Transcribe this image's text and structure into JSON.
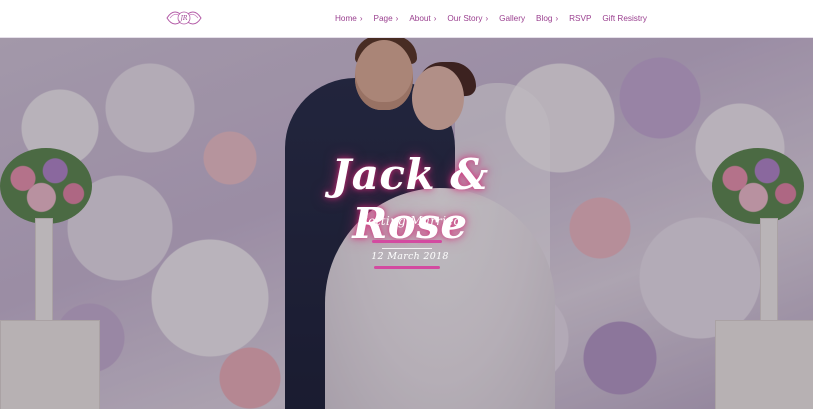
{
  "brand": {
    "logo_text": "JR",
    "accent": "#9a3f8f"
  },
  "nav": {
    "items": [
      {
        "label": "Home",
        "dropdown": true
      },
      {
        "label": "Page",
        "dropdown": true
      },
      {
        "label": "About",
        "dropdown": true
      },
      {
        "label": "Our Story",
        "dropdown": true
      },
      {
        "label": "Gallery",
        "dropdown": false
      },
      {
        "label": "Blog",
        "dropdown": true
      },
      {
        "label": "RSVP",
        "dropdown": false
      },
      {
        "label": "Gift Resistry",
        "dropdown": false
      }
    ],
    "chevron": "›"
  },
  "hero": {
    "headline": "Jack & Rose",
    "subtitle": "Getting Married",
    "date": "12 March 2018"
  }
}
